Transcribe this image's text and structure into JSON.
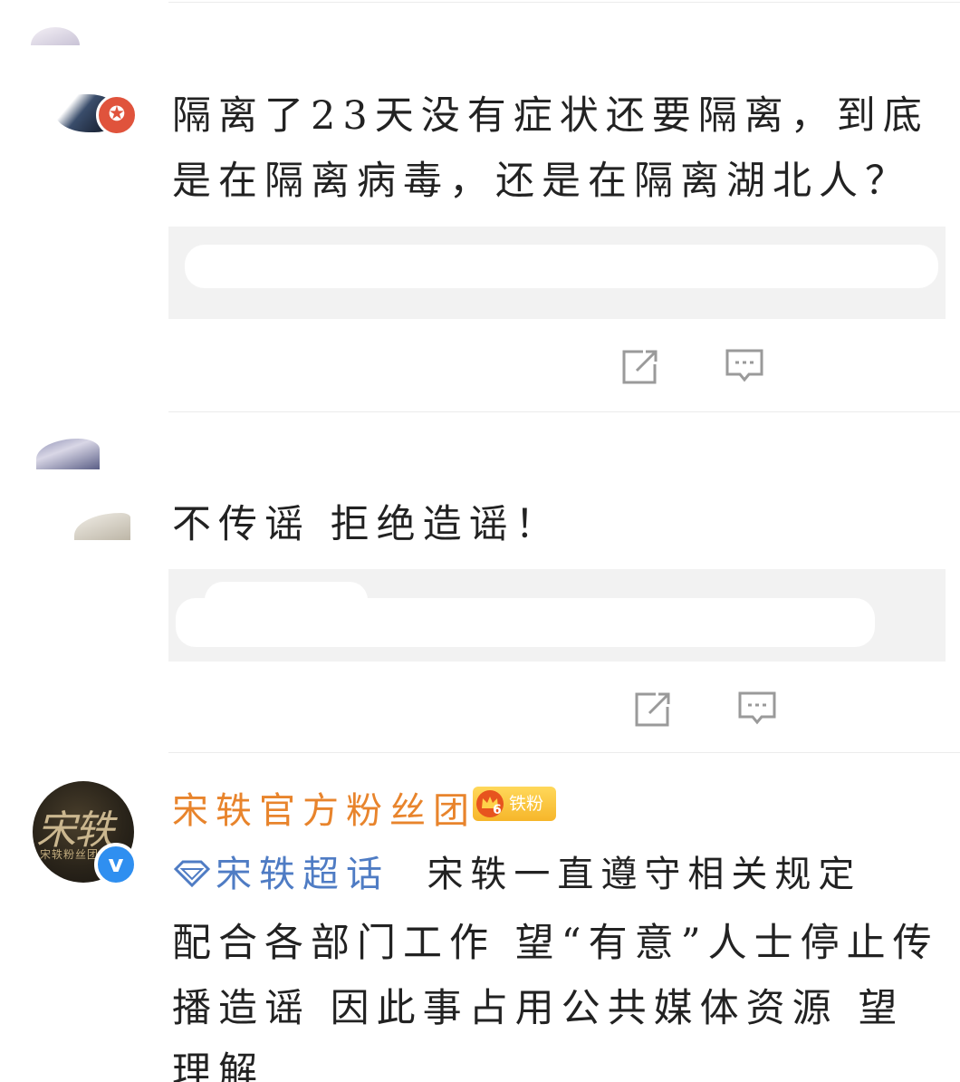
{
  "posts": [
    {
      "text_lines": [
        "隔离了23天没有症状还要隔离，到底",
        "是在隔离病毒，还是在隔离湖北人？"
      ],
      "actions": {
        "share_icon": "share-icon",
        "comment_icon": "comment-icon"
      }
    },
    {
      "text_lines": [
        "不传谣 拒绝造谣！"
      ],
      "actions": {
        "share_icon": "share-icon",
        "comment_icon": "comment-icon"
      }
    },
    {
      "username": "宋轶官方粉丝团",
      "fan_badge": {
        "level": "6",
        "label": "铁粉"
      },
      "avatar": {
        "text": "宋轶",
        "sub": "宋轶粉丝团"
      },
      "topic": "宋轶超话",
      "text_lines": [
        "宋轶一直遵守相关规定",
        "配合各部门工作 望“有意”人士停止传",
        "播造谣 因此事占用公共媒体资源 望",
        "理解"
      ]
    }
  ],
  "colors": {
    "username": "#e8842c",
    "topic": "#4f7cc4",
    "verified": "#2f8ff0",
    "badge": "#f6b62a"
  }
}
